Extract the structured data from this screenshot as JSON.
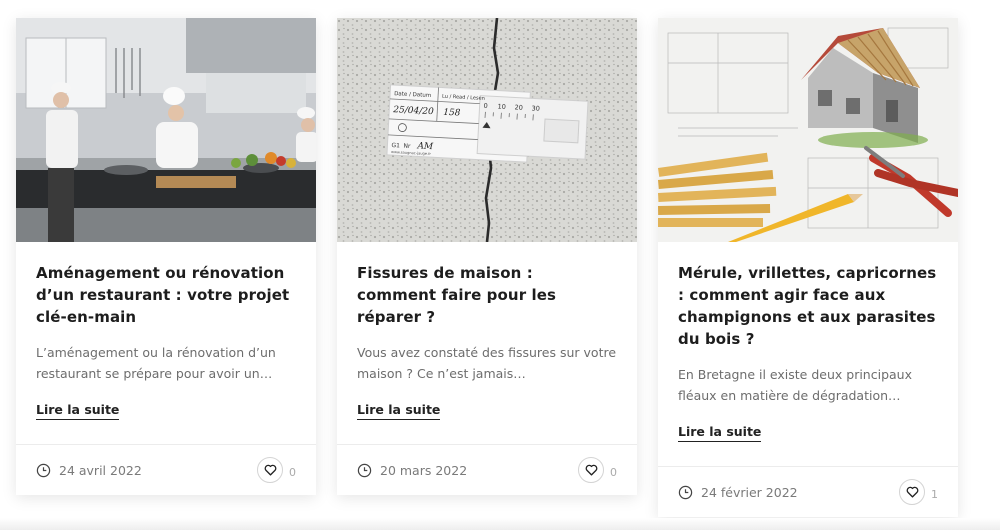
{
  "cards": [
    {
      "title": "Aménagement ou rénovation d’un restaurant : votre projet clé-en-main",
      "excerpt": "L’aménagement ou la rénovation d’un restaurant se prépare pour avoir un…",
      "read_more": "Lire la suite",
      "date": "24 avril 2022",
      "likes": "0",
      "image_icon": "restaurant-kitchen-photo"
    },
    {
      "title": "Fissures de maison : comment faire pour les réparer ?",
      "excerpt": "Vous avez constaté des fissures sur votre maison ? Ce n’est jamais…",
      "read_more": "Lire la suite",
      "date": "20 mars 2022",
      "likes": "0",
      "image_icon": "wall-crack-gauge-photo"
    },
    {
      "title": "Mérule, vrillettes, capricornes : comment agir face aux champignons et aux parasites du bois ?",
      "excerpt": "En Bretagne il existe deux principaux fléaux en matière de dégradation…",
      "read_more": "Lire la suite",
      "date": "24 février 2022",
      "likes": "1",
      "image_icon": "house-model-blueprint-photo"
    }
  ],
  "gauge": {
    "label_date": "Date / Datum",
    "label_lu": "Lu / Read / Lesen",
    "handwritten_date": "25/04/20",
    "handwritten_value": "158",
    "g1": "G1",
    "nr": "Nr",
    "handwritten_nr": "AM",
    "scale": [
      "0",
      "10",
      "20",
      "30"
    ],
    "url": "www.saugnac-jauge.fr"
  },
  "colors": {
    "title": "#1d1d1d",
    "excerpt": "#6d6d6d",
    "footer_text": "#7a7a7a"
  }
}
